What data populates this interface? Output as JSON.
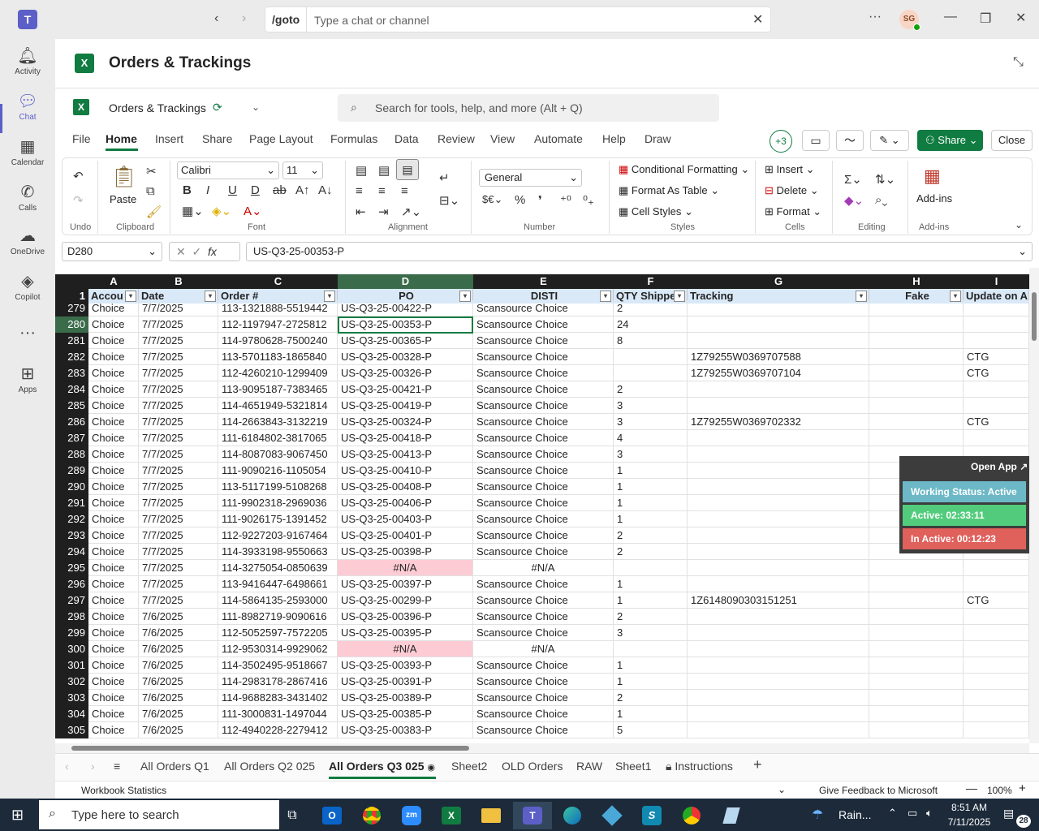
{
  "teams": {
    "goto": "/goto",
    "search_placeholder": "Type a chat or channel",
    "avatar": "SG",
    "rail": [
      {
        "label": "Activity",
        "icon": "bell-icon"
      },
      {
        "label": "Chat",
        "icon": "chat-icon"
      },
      {
        "label": "Calendar",
        "icon": "calendar-icon"
      },
      {
        "label": "Calls",
        "icon": "phone-icon"
      },
      {
        "label": "OneDrive",
        "icon": "cloud-icon"
      },
      {
        "label": "Copilot",
        "icon": "copilot-icon"
      },
      {
        "label": "Apps",
        "icon": "apps-icon"
      }
    ],
    "app_title": "Orders & Trackings"
  },
  "excel": {
    "doc_name": "Orders & Trackings",
    "search_placeholder": "Search for tools, help, and more (Alt + Q)",
    "tabs": [
      "File",
      "Home",
      "Insert",
      "Share",
      "Page Layout",
      "Formulas",
      "Data",
      "Review",
      "View",
      "Automate",
      "Help",
      "Draw"
    ],
    "plus_count": "+3",
    "share": "Share",
    "close": "Close",
    "paste": "Paste",
    "font_name": "Calibri",
    "font_size": "11",
    "number_format": "General",
    "styles": [
      "Conditional Formatting",
      "Format As Table",
      "Cell Styles"
    ],
    "cells": [
      "Insert",
      "Delete",
      "Format"
    ],
    "addins": "Add-ins",
    "groups": [
      "Undo",
      "Clipboard",
      "Font",
      "Alignment",
      "Number",
      "Styles",
      "Cells",
      "Editing",
      "Add-ins"
    ],
    "name_box": "D280",
    "formula": "US-Q3-25-00353-P",
    "col_letters": [
      "A",
      "B",
      "C",
      "D",
      "E",
      "F",
      "G",
      "H",
      "I"
    ],
    "headers": [
      "Accou",
      "Date",
      "Order #",
      "PO",
      "DISTI",
      "QTY Shippe",
      "Tracking",
      "Fake",
      "Update on Ar"
    ],
    "rows": [
      [
        "279",
        "Choice",
        "7/7/2025",
        "113-1321888-5519442",
        "US-Q3-25-00422-P",
        "Scansource Choice",
        "2",
        "",
        "",
        ""
      ],
      [
        "280",
        "Choice",
        "7/7/2025",
        "112-1197947-2725812",
        "US-Q3-25-00353-P",
        "Scansource Choice",
        "24",
        "",
        "",
        ""
      ],
      [
        "281",
        "Choice",
        "7/7/2025",
        "114-9780628-7500240",
        "US-Q3-25-00365-P",
        "Scansource Choice",
        "8",
        "",
        "",
        ""
      ],
      [
        "282",
        "Choice",
        "7/7/2025",
        "113-5701183-1865840",
        "US-Q3-25-00328-P",
        "Scansource Choice",
        "",
        "1Z79255W0369707588",
        "",
        "CTG"
      ],
      [
        "283",
        "Choice",
        "7/7/2025",
        "112-4260210-1299409",
        "US-Q3-25-00326-P",
        "Scansource Choice",
        "",
        "1Z79255W0369707104",
        "",
        "CTG"
      ],
      [
        "284",
        "Choice",
        "7/7/2025",
        "113-9095187-7383465",
        "US-Q3-25-00421-P",
        "Scansource Choice",
        "2",
        "",
        "",
        ""
      ],
      [
        "285",
        "Choice",
        "7/7/2025",
        "114-4651949-5321814",
        "US-Q3-25-00419-P",
        "Scansource Choice",
        "3",
        "",
        "",
        ""
      ],
      [
        "286",
        "Choice",
        "7/7/2025",
        "114-2663843-3132219",
        "US-Q3-25-00324-P",
        "Scansource Choice",
        "3",
        "1Z79255W0369702332",
        "",
        "CTG"
      ],
      [
        "287",
        "Choice",
        "7/7/2025",
        "111-6184802-3817065",
        "US-Q3-25-00418-P",
        "Scansource Choice",
        "4",
        "",
        "",
        ""
      ],
      [
        "288",
        "Choice",
        "7/7/2025",
        "114-8087083-9067450",
        "US-Q3-25-00413-P",
        "Scansource Choice",
        "3",
        "",
        "",
        ""
      ],
      [
        "289",
        "Choice",
        "7/7/2025",
        "111-9090216-1105054",
        "US-Q3-25-00410-P",
        "Scansource Choice",
        "1",
        "",
        "",
        ""
      ],
      [
        "290",
        "Choice",
        "7/7/2025",
        "113-5117199-5108268",
        "US-Q3-25-00408-P",
        "Scansource Choice",
        "1",
        "",
        "",
        ""
      ],
      [
        "291",
        "Choice",
        "7/7/2025",
        "111-9902318-2969036",
        "US-Q3-25-00406-P",
        "Scansource Choice",
        "1",
        "",
        "",
        ""
      ],
      [
        "292",
        "Choice",
        "7/7/2025",
        "111-9026175-1391452",
        "US-Q3-25-00403-P",
        "Scansource Choice",
        "1",
        "",
        "",
        ""
      ],
      [
        "293",
        "Choice",
        "7/7/2025",
        "112-9227203-9167464",
        "US-Q3-25-00401-P",
        "Scansource Choice",
        "2",
        "",
        "",
        ""
      ],
      [
        "294",
        "Choice",
        "7/7/2025",
        "114-3933198-9550663",
        "US-Q3-25-00398-P",
        "Scansource Choice",
        "2",
        "",
        "",
        ""
      ],
      [
        "295",
        "Choice",
        "7/7/2025",
        "114-3275054-0850639",
        "#N/A",
        "#N/A",
        "",
        "",
        "",
        ""
      ],
      [
        "296",
        "Choice",
        "7/7/2025",
        "113-9416447-6498661",
        "US-Q3-25-00397-P",
        "Scansource Choice",
        "1",
        "",
        "",
        ""
      ],
      [
        "297",
        "Choice",
        "7/7/2025",
        "114-5864135-2593000",
        "US-Q3-25-00299-P",
        "Scansource Choice",
        "1",
        "1Z6148090303151251",
        "",
        "CTG"
      ],
      [
        "298",
        "Choice",
        "7/6/2025",
        "111-8982719-9090616",
        "US-Q3-25-00396-P",
        "Scansource Choice",
        "2",
        "",
        "",
        ""
      ],
      [
        "299",
        "Choice",
        "7/6/2025",
        "112-5052597-7572205",
        "US-Q3-25-00395-P",
        "Scansource Choice",
        "3",
        "",
        "",
        ""
      ],
      [
        "300",
        "Choice",
        "7/6/2025",
        "112-9530314-9929062",
        "#N/A",
        "#N/A",
        "",
        "",
        "",
        ""
      ],
      [
        "301",
        "Choice",
        "7/6/2025",
        "114-3502495-9518667",
        "US-Q3-25-00393-P",
        "Scansource Choice",
        "1",
        "",
        "",
        ""
      ],
      [
        "302",
        "Choice",
        "7/6/2025",
        "114-2983178-2867416",
        "US-Q3-25-00391-P",
        "Scansource Choice",
        "1",
        "",
        "",
        ""
      ],
      [
        "303",
        "Choice",
        "7/6/2025",
        "114-9688283-3431402",
        "US-Q3-25-00389-P",
        "Scansource Choice",
        "2",
        "",
        "",
        ""
      ],
      [
        "304",
        "Choice",
        "7/6/2025",
        "111-3000831-1497044",
        "US-Q3-25-00385-P",
        "Scansource Choice",
        "1",
        "",
        "",
        ""
      ],
      [
        "305",
        "Choice",
        "7/6/2025",
        "112-4940228-2279412",
        "US-Q3-25-00383-P",
        "Scansource Choice",
        "5",
        "",
        "",
        ""
      ]
    ],
    "sheets": [
      "All Orders Q1",
      "All Orders Q2 025",
      "All Orders Q3 025",
      "Sheet2",
      "OLD Orders",
      "RAW",
      "Sheet1",
      "Instructions"
    ],
    "status_left": "Workbook Statistics",
    "feedback": "Give Feedback to Microsoft",
    "zoom": "100%"
  },
  "widget": {
    "open_app": "Open App ↗",
    "status": "Working Status: Active",
    "active": "Active: 02:33:11",
    "inactive": "In Active: 00:12:23"
  },
  "taskbar": {
    "search_placeholder": "Type here to search",
    "weather": "Rain...",
    "time": "8:51 AM",
    "date": "7/11/2025",
    "notif": "28"
  },
  "colors": {
    "teams_purple": "#5b5fc7",
    "excel_green": "#107c41",
    "header_fill": "#dae9f8",
    "na_fill": "#fdcbd4"
  }
}
